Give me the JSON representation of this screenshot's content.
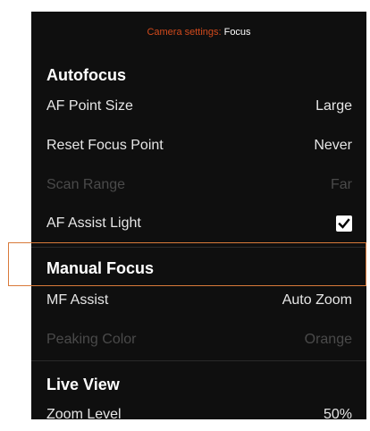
{
  "header": {
    "prefix": "Camera settings:",
    "name": "Focus"
  },
  "sections": {
    "autofocus": {
      "title": "Autofocus",
      "rows": [
        {
          "label": "AF Point Size",
          "value": "Large"
        },
        {
          "label": "Reset Focus Point",
          "value": "Never"
        },
        {
          "label": "Scan Range",
          "value": "Far",
          "disabled": true
        },
        {
          "label": "AF Assist Light",
          "checked": true
        }
      ]
    },
    "manual_focus": {
      "title": "Manual Focus",
      "rows": [
        {
          "label": "MF Assist",
          "value": "Auto Zoom"
        },
        {
          "label": "Peaking Color",
          "value": "Orange",
          "disabled": true
        }
      ]
    },
    "live_view": {
      "title": "Live View",
      "rows": [
        {
          "label": "Zoom Level",
          "value": "50%"
        }
      ]
    }
  },
  "colors": {
    "accent": "#d24a1c",
    "highlight_border": "#d97a3a",
    "background": "#0f0f0f",
    "disabled_text": "#4a4a4a"
  },
  "icons": {
    "checkbox": "checkmark-icon"
  }
}
